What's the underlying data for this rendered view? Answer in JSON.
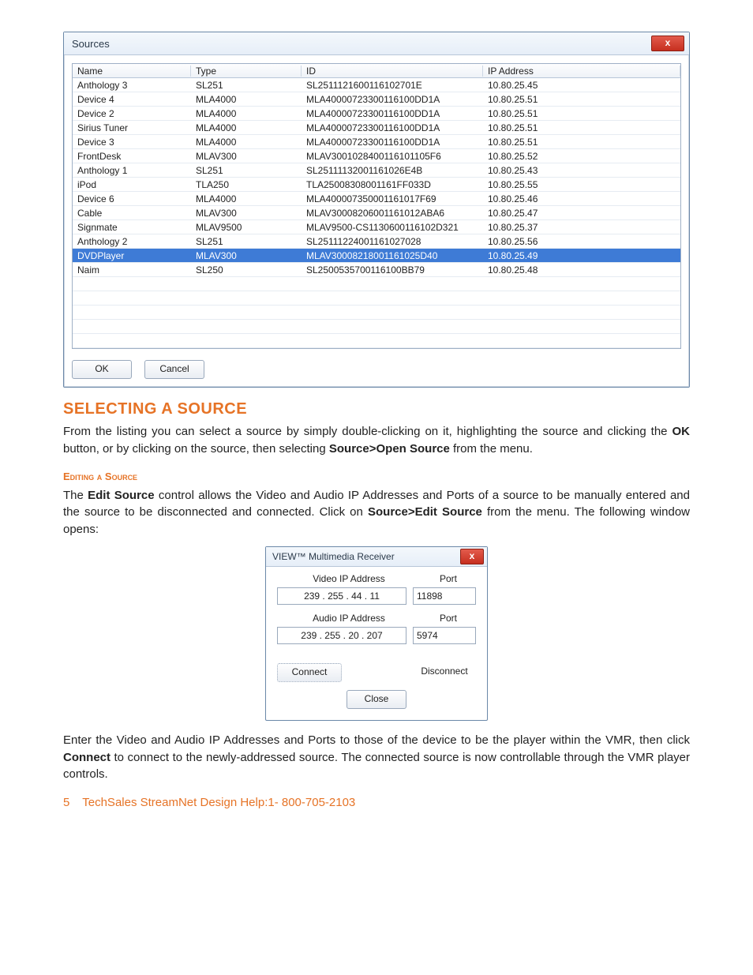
{
  "sources_window": {
    "title": "Sources",
    "close_glyph": "x",
    "columns": {
      "name": "Name",
      "type": "Type",
      "id": "ID",
      "ip": "IP Address"
    },
    "rows": [
      {
        "name": "Anthology 3",
        "type": "SL251",
        "id": "SL2511121600116102701E",
        "ip": "10.80.25.45",
        "selected": false
      },
      {
        "name": "Device 4",
        "type": "MLA4000",
        "id": "MLA40000723300116100DD1A",
        "ip": "10.80.25.51",
        "selected": false
      },
      {
        "name": "Device 2",
        "type": "MLA4000",
        "id": "MLA40000723300116100DD1A",
        "ip": "10.80.25.51",
        "selected": false
      },
      {
        "name": "Sirius Tuner",
        "type": "MLA4000",
        "id": "MLA40000723300116100DD1A",
        "ip": "10.80.25.51",
        "selected": false
      },
      {
        "name": "Device 3",
        "type": "MLA4000",
        "id": "MLA40000723300116100DD1A",
        "ip": "10.80.25.51",
        "selected": false
      },
      {
        "name": "FrontDesk",
        "type": "MLAV300",
        "id": "MLAV3001028400116101105F6",
        "ip": "10.80.25.52",
        "selected": false
      },
      {
        "name": "Anthology 1",
        "type": "SL251",
        "id": "SL25111132001161026E4B",
        "ip": "10.80.25.43",
        "selected": false
      },
      {
        "name": "iPod",
        "type": "TLA250",
        "id": "TLA25008308001161FF033D",
        "ip": "10.80.25.55",
        "selected": false
      },
      {
        "name": "Device 6",
        "type": "MLA4000",
        "id": "MLA400007350001161017F69",
        "ip": "10.80.25.46",
        "selected": false
      },
      {
        "name": "Cable",
        "type": "MLAV300",
        "id": "MLAV30008206001161012ABA6",
        "ip": "10.80.25.47",
        "selected": false
      },
      {
        "name": "Signmate",
        "type": "MLAV9500",
        "id": "MLAV9500-CS1130600116102D321",
        "ip": "10.80.25.37",
        "selected": false
      },
      {
        "name": "Anthology 2",
        "type": "SL251",
        "id": "SL25111224001161027028",
        "ip": "10.80.25.56",
        "selected": false
      },
      {
        "name": "DVDPlayer",
        "type": "MLAV300",
        "id": "MLAV30008218001161025D40",
        "ip": "10.80.25.49",
        "selected": true
      },
      {
        "name": "Naim",
        "type": "SL250",
        "id": "SL2500535700116100BB79",
        "ip": "10.80.25.48",
        "selected": false
      }
    ],
    "empty_rows": 5,
    "ok_label": "OK",
    "cancel_label": "Cancel"
  },
  "heading_select": "SELECTING A SOURCE",
  "para_select_1a": "From the listing you can select a source by simply double-clicking on it, highlighting the source and clicking the ",
  "para_select_1b": " button, or by clicking on the source, then selecting ",
  "para_select_1c": " from the menu.",
  "bold_ok": "OK",
  "bold_open": "Source>Open Source",
  "subhead_edit": "Editing a Source",
  "para_edit_1a": "The ",
  "bold_edit_source": "Edit Source",
  "para_edit_1b": " control allows the Video and Audio IP Addresses and Ports of a source to be manually entered and the source to be disconnected and connected. Click on ",
  "bold_source_edit": "Source>Edit Source",
  "para_edit_1c": " from the menu. The following window opens:",
  "dlg": {
    "title": "VIEW™ Multimedia Receiver",
    "close_glyph": "x",
    "video_ip_label": "Video IP Address",
    "audio_ip_label": "Audio IP Address",
    "port_label": "Port",
    "video_ip": "239 . 255 .  44  .  11",
    "video_port": "11898",
    "audio_ip": "239 . 255 .  20 . 207",
    "audio_port": "5974",
    "connect_label": "Connect",
    "disconnect_label": "Disconnect",
    "close_label": "Close"
  },
  "para_after_1a": "Enter the Video and Audio IP Addresses and Ports to those of the device to be the player within the VMR, then click ",
  "bold_connect": "Connect",
  "para_after_1b": " to connect to the newly-addressed source. The connected source is now controllable through the VMR player controls.",
  "footer": {
    "page": "5",
    "text": "TechSales StreamNet Design Help:1- 800-705-2103"
  }
}
